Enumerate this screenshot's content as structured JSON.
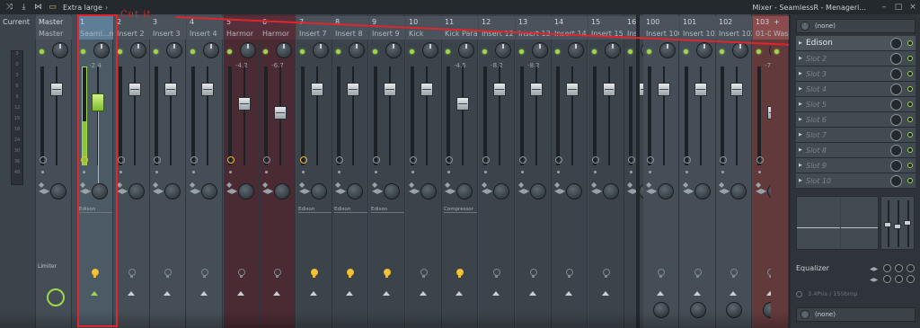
{
  "titlebar": {
    "zoom_label": "Extra large",
    "zoom_arrow": "›",
    "window_title": "Mixer - SeamlessR - Menageri...",
    "btn_minimize": "–",
    "btn_restore": "□",
    "btn_close": "×",
    "icons": [
      "route-icon",
      "cut-icon",
      "wave-icon",
      "folder-icon"
    ]
  },
  "mixer": {
    "current": {
      "label": "Current"
    },
    "master": {
      "label": "Master",
      "limiter_label": "Limiter"
    },
    "strips": [
      {
        "num": "1",
        "name": "Seaml...mier",
        "db": "-2.4",
        "slot": "Edison"
      },
      {
        "num": "2",
        "name": "Insert 2",
        "db": "",
        "slot": ""
      },
      {
        "num": "3",
        "name": "Insert 3",
        "db": "",
        "slot": ""
      },
      {
        "num": "4",
        "name": "Insert 4",
        "db": "",
        "slot": ""
      },
      {
        "num": "5",
        "name": "Harmor",
        "db": "-4.2",
        "slot": ""
      },
      {
        "num": "6",
        "name": "Harmor",
        "db": "-6.7",
        "slot": ""
      },
      {
        "num": "7",
        "name": "Insert 7",
        "db": "",
        "slot": "Edison"
      },
      {
        "num": "8",
        "name": "Insert 8",
        "db": "",
        "slot": "Edison"
      },
      {
        "num": "9",
        "name": "Insert 9",
        "db": "",
        "slot": "Edison"
      },
      {
        "num": "10",
        "name": "Kick",
        "db": "",
        "slot": ""
      },
      {
        "num": "11",
        "name": "Kick Parallel",
        "db": "-4.5",
        "slot": "Compressor"
      },
      {
        "num": "12",
        "name": "Insert 12",
        "db": "-8.2",
        "slot": ""
      },
      {
        "num": "13",
        "name": "Insert 13",
        "db": "-8.2",
        "slot": ""
      },
      {
        "num": "14",
        "name": "Insert 14",
        "db": "",
        "slot": ""
      },
      {
        "num": "15",
        "name": "Insert 15",
        "db": "",
        "slot": ""
      },
      {
        "num": "16",
        "name": "Ins",
        "db": "",
        "slot": ""
      },
      {
        "num": "100",
        "name": "Insert 100",
        "db": "",
        "slot": ""
      },
      {
        "num": "101",
        "name": "Insert 101",
        "db": "",
        "slot": ""
      },
      {
        "num": "102",
        "name": "Insert 102",
        "db": "",
        "slot": ""
      },
      {
        "num": "103",
        "name": "01-04",
        "db": "-7.6",
        "slot": ""
      },
      {
        "num": "+",
        "name": "Was",
        "db": "",
        "slot": ""
      }
    ],
    "scale_marks": [
      "3",
      "0",
      "3",
      "6",
      "9",
      "12",
      "15",
      "18",
      "24",
      "30",
      "36",
      "48"
    ]
  },
  "annotation": {
    "label": "Cut it",
    "color": "#e0262c"
  },
  "panel": {
    "top_select": "(none)",
    "slots": [
      "Edison",
      "Slot 2",
      "Slot 3",
      "Slot 4",
      "Slot 5",
      "Slot 6",
      "Slot 7",
      "Slot 8",
      "Slot 9",
      "Slot 10"
    ],
    "eq_label": "Equalizer",
    "tempo_label": "3.4Pris / 155bmp",
    "bottom_select": "(none)"
  },
  "colors": {
    "accent_green": "#9ed84a",
    "strip_blue": "#5d7e96",
    "strip_maroon": "#552f3a",
    "strip_red": "#8a4c4c"
  }
}
